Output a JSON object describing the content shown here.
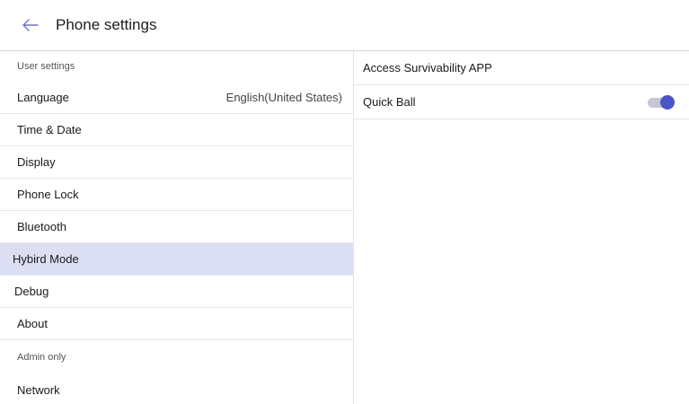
{
  "header": {
    "title": "Phone settings",
    "back_icon": "arrow-left-icon"
  },
  "sidebar": {
    "user_section_label": "User settings",
    "items": [
      {
        "label": "Language",
        "value": "English(United States)"
      },
      {
        "label": "Time & Date"
      },
      {
        "label": "Display"
      },
      {
        "label": "Phone Lock"
      },
      {
        "label": "Bluetooth"
      },
      {
        "label": "Hybird Mode",
        "selected": true
      },
      {
        "label": "Debug"
      },
      {
        "label": "About"
      }
    ],
    "admin_section_label": "Admin only",
    "admin_items": [
      {
        "label": "Network"
      }
    ]
  },
  "detail": {
    "rows": [
      {
        "label": "Access Survivability APP"
      },
      {
        "label": "Quick Ball",
        "toggle_on": true
      }
    ]
  },
  "colors": {
    "accent": "#4a55c9",
    "selected_bg": "#dcdff3",
    "toggle_track": "#c5c7d3"
  }
}
